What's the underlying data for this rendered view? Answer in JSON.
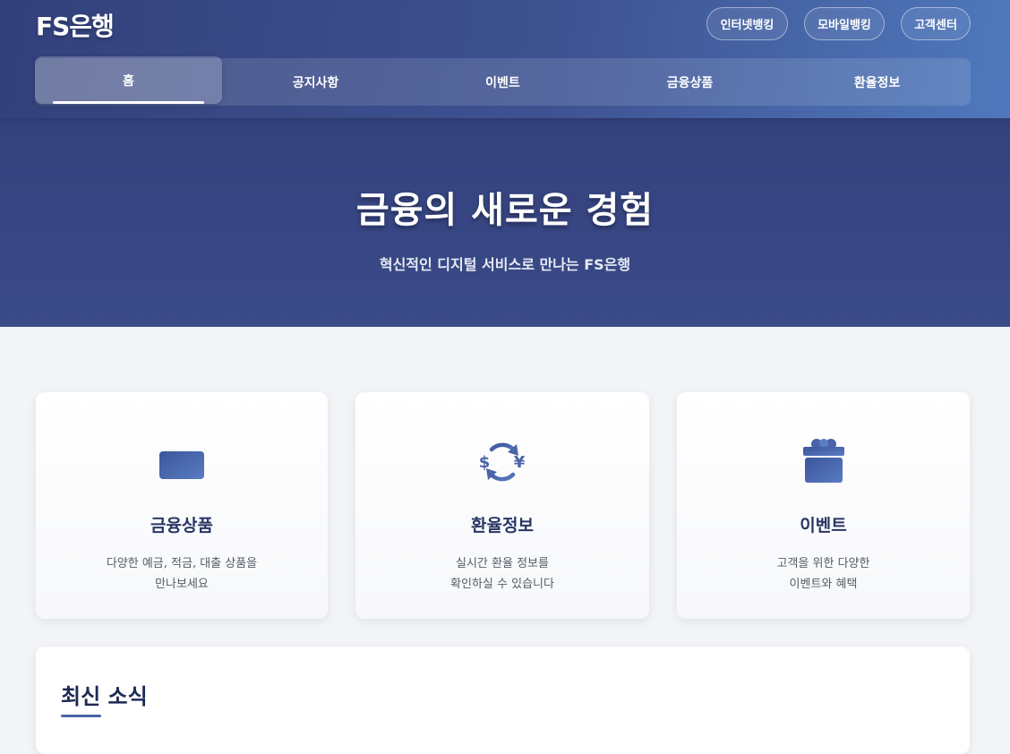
{
  "header": {
    "logo": "FS은행",
    "top_links": [
      "인터넷뱅킹",
      "모바일뱅킹",
      "고객센터"
    ]
  },
  "nav": {
    "items": [
      "홈",
      "공지사항",
      "이벤트",
      "금융상품",
      "환율정보"
    ],
    "active": "홈"
  },
  "hero": {
    "title": "금융의 새로운 경험",
    "subtitle": "혁신적인 디지털 서비스로 만나는 FS은행"
  },
  "cards": [
    {
      "icon": "credit-card-icon",
      "title": "금융상품",
      "desc_line1": "다양한 예금, 적금, 대출 상품을",
      "desc_line2": "만나보세요"
    },
    {
      "icon": "currency-exchange-icon",
      "title": "환율정보",
      "desc_line1": "실시간 환율 정보를",
      "desc_line2": "확인하실 수 있습니다"
    },
    {
      "icon": "gift-icon",
      "title": "이벤트",
      "desc_line1": "고객을 위한 다양한",
      "desc_line2": "이벤트와 혜택"
    }
  ],
  "news": {
    "title": "최신 소식"
  },
  "colors": {
    "brand_dark": "#32407a",
    "brand_light": "#4f79bd",
    "icon": "#4a64a8",
    "title_text": "#283665"
  }
}
